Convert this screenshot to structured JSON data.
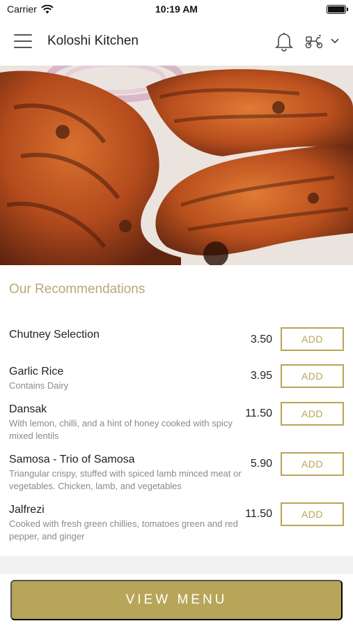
{
  "status_bar": {
    "carrier": "Carrier",
    "time": "10:19 AM"
  },
  "header": {
    "title": "Koloshi Kitchen"
  },
  "icons": {
    "menu": "hamburger-icon",
    "notifications": "bell-icon",
    "delivery": "scooter-icon",
    "dropdown": "chevron-down-icon"
  },
  "hero": {
    "alt": "tandoori-chicken-image"
  },
  "section": {
    "title": "Our Recommendations"
  },
  "items": [
    {
      "name": "Chutney Selection",
      "description": "",
      "price": "3.50",
      "add_label": "ADD"
    },
    {
      "name": "Garlic Rice",
      "description": "Contains Dairy",
      "price": "3.95",
      "add_label": "ADD"
    },
    {
      "name": "Dansak",
      "description": "With lemon, chilli, and a hint of honey cooked with spicy mixed lentils",
      "price": "11.50",
      "add_label": "ADD"
    },
    {
      "name": "Samosa - Trio of Samosa",
      "description": "Triangular crispy, stuffed with spiced lamb minced meat or vegetables. Chicken, lamb, and vegetables",
      "price": "5.90",
      "add_label": "ADD"
    },
    {
      "name": "Jalfrezi",
      "description": "Cooked with fresh green chillies, tomatoes green and red pepper, and ginger",
      "price": "11.50",
      "add_label": "ADD"
    }
  ],
  "footer": {
    "view_menu_label": "VIEW MENU"
  },
  "colors": {
    "accent": "#b7a659",
    "section_title": "#b9a77c"
  }
}
